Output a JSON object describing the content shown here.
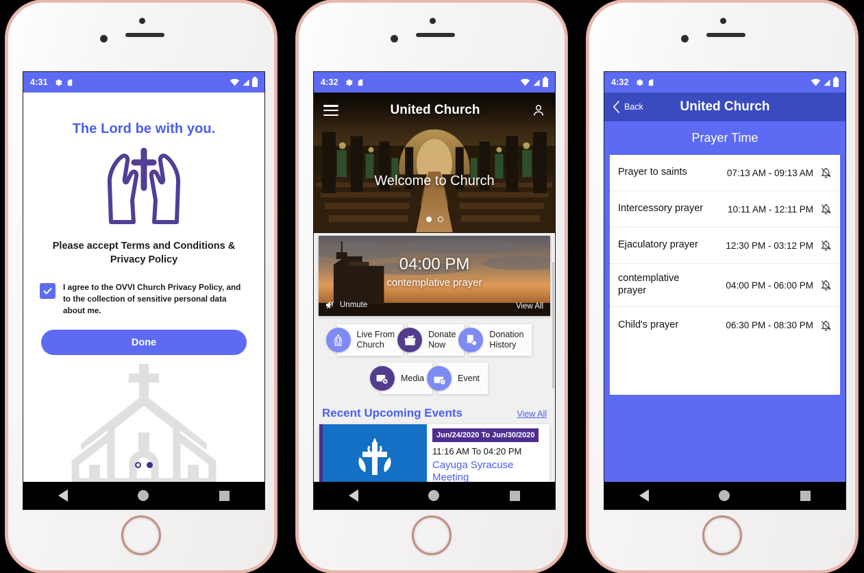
{
  "phone1": {
    "status": {
      "time": "4:31",
      "icons": [
        "gear-icon",
        "sim-icon",
        "wifi-icon",
        "signal-icon",
        "battery-icon"
      ]
    },
    "heading": "The Lord be with you.",
    "logo": "praying-hands-cross-logo",
    "terms_line1": "Please accept Terms and Conditions &",
    "terms_line2": "Privacy Policy",
    "checkbox_checked": true,
    "consent_text": "I agree to the OVVI Church Privacy Policy, and to the collection of sensitive personal data about me.",
    "done_label": "Done",
    "pager": {
      "total": 2,
      "active": 2
    }
  },
  "phone2": {
    "status": {
      "time": "4:32"
    },
    "app_title": "United Church",
    "menu_icon": "hamburger-menu-icon",
    "profile_icon": "user-account-icon",
    "hero_caption": "Welcome to Church",
    "hero_pager": {
      "total": 2,
      "active": 1
    },
    "prayer_card": {
      "time": "04:00 PM",
      "name": "contemplative prayer",
      "mute_label": "Unmute",
      "mute_icon": "speaker-muted-icon",
      "view_all": "View All"
    },
    "tiles": [
      {
        "label_line1": "Live From",
        "label_line2": "Church",
        "icon": "praying-hands-icon",
        "tone": "light"
      },
      {
        "label_line1": "Donate",
        "label_line2": "Now",
        "icon": "donation-box-icon",
        "tone": "dark"
      },
      {
        "label_line1": "Donation",
        "label_line2": "History",
        "icon": "receipt-history-icon",
        "tone": "light"
      },
      {
        "label_line1": "Media",
        "label_line2": "",
        "icon": "media-play-icon",
        "tone": "dark"
      },
      {
        "label_line1": "Event",
        "label_line2": "",
        "icon": "calendar-clock-icon",
        "tone": "light"
      }
    ],
    "events_title": "Recent Upcoming Events",
    "events_view_all": "View All",
    "event": {
      "date_range": "Jun/24/2020 To Jun/30/2020",
      "time_range": "11:16 AM To 04:20 PM",
      "name": "Cayuga Syracuse Meeting",
      "thumb": "presbyterian-cross-logo"
    }
  },
  "phone3": {
    "status": {
      "time": "4:32"
    },
    "back_label": "Back",
    "back_icon": "chevron-left-icon",
    "app_title": "United Church",
    "section_title": "Prayer Time",
    "bell_icon": "bell-off-icon",
    "prayers": [
      {
        "name": "Prayer to saints",
        "time": "07:13 AM - 09:13 AM"
      },
      {
        "name": "Intercessory prayer",
        "time": "10:11 AM - 12:11 PM"
      },
      {
        "name": "Ejaculatory prayer",
        "time": "12:30 PM - 03:12 PM"
      },
      {
        "name": "contemplative prayer",
        "time": "04:00 PM - 06:00 PM"
      },
      {
        "name": "Child's prayer",
        "time": "06:30 PM - 08:30 PM"
      }
    ]
  },
  "colors": {
    "accent_blue": "#5c6bf2",
    "link_blue": "#4a5ef0",
    "dark_blue": "#3a4bbf",
    "purple": "#4d2e8e",
    "logo_purple": "#513e96"
  },
  "navbar": {
    "back": "back-triangle-icon",
    "home": "home-circle-icon",
    "recents": "recents-square-icon"
  }
}
